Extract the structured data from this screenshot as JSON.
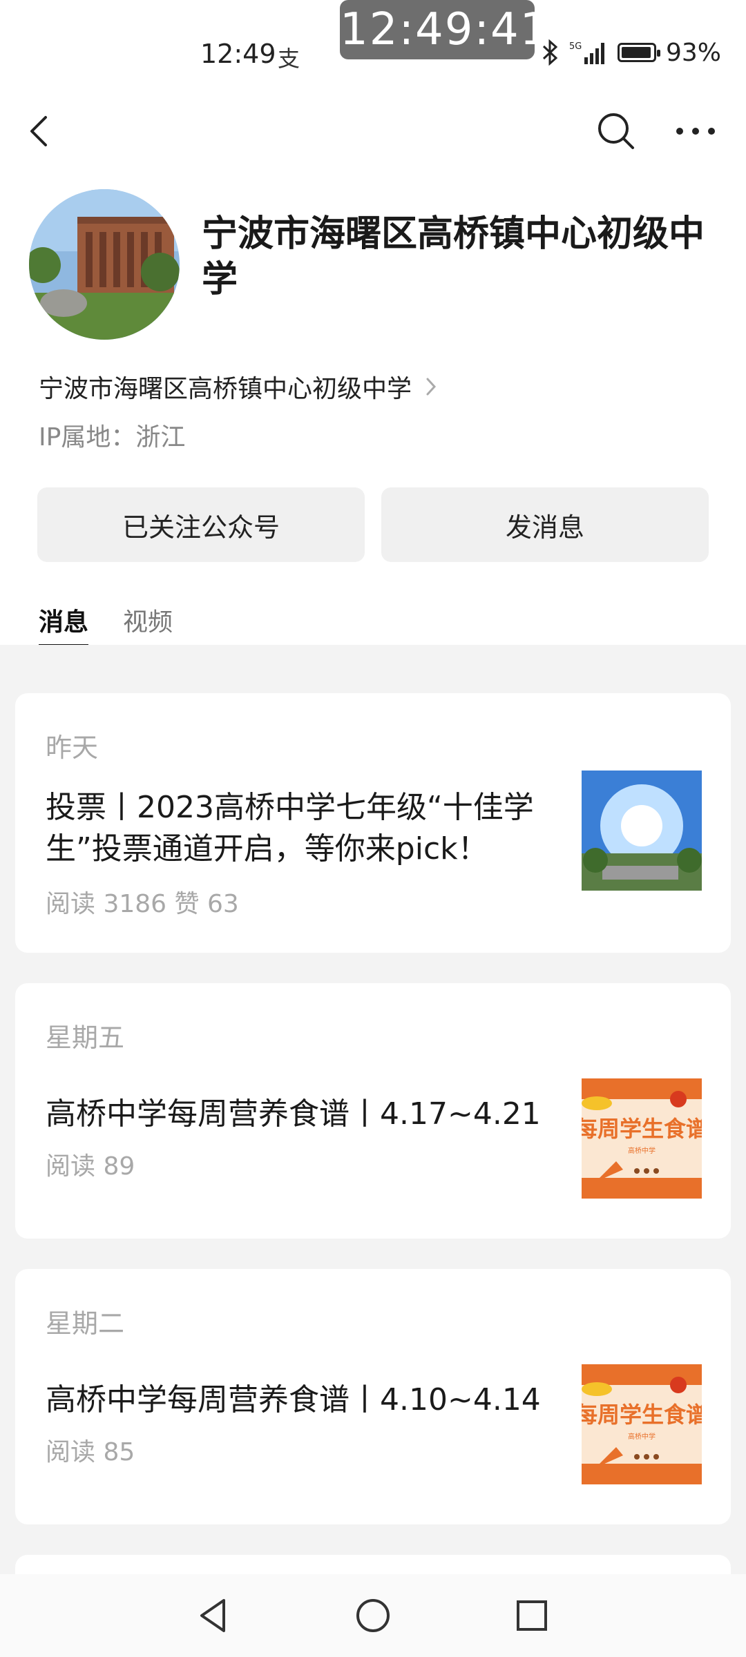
{
  "status_bar": {
    "time": "12:49",
    "time_icon": "支",
    "big_clock": "12:49:41",
    "network": "5G",
    "battery_percent": "93%",
    "battery_level": 0.93
  },
  "nav": {
    "back_icon": "chevron-left-icon",
    "search_icon": "search-icon",
    "more_icon": "more-horizontal-icon"
  },
  "profile": {
    "title": "宁波市海曙区高桥镇中心初级中学",
    "subject_name": "宁波市海曙区高桥镇中心初级中学",
    "ip_location": "IP属地：浙江"
  },
  "actions": {
    "follow_label": "已关注公众号",
    "message_label": "发消息"
  },
  "tabs": [
    {
      "label": "消息",
      "active": true
    },
    {
      "label": "视频",
      "active": false
    }
  ],
  "articles": [
    {
      "date": "昨天",
      "title": "投票丨2023高桥中学七年级“十佳学生”投票通道开启，等你来pick！",
      "meta": "阅读 3186  赞 63"
    },
    {
      "date": "星期五",
      "title": "高桥中学每周营养食谱丨4.17~4.21",
      "meta": "阅读 89",
      "thumb_text": "每周学生食谱",
      "thumb_sub": "高桥中学"
    },
    {
      "date": "星期二",
      "title": "高桥中学每周营养食谱丨4.10~4.14",
      "meta": "阅读 85",
      "thumb_text": "每周学生食谱",
      "thumb_sub": "高桥中学"
    }
  ],
  "colors": {
    "accent_orange": "#e8702a",
    "card_bg": "#ffffff",
    "feed_bg": "#f3f3f3",
    "button_bg": "#f0f0f0"
  }
}
